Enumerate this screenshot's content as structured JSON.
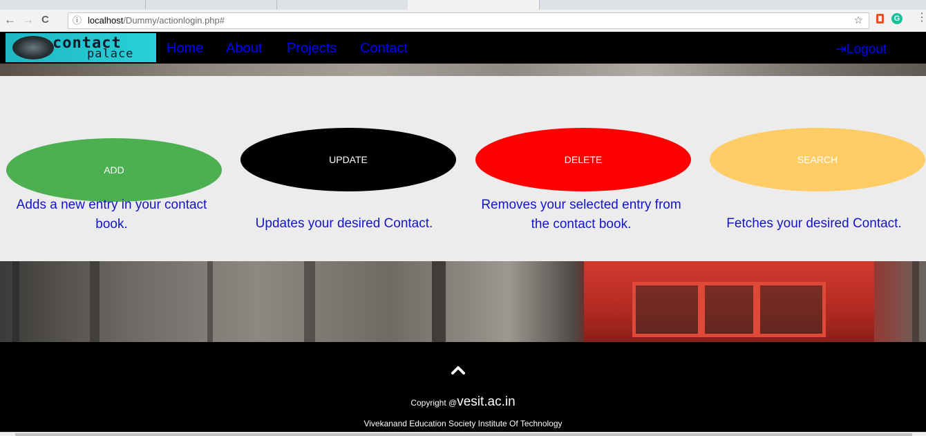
{
  "browser": {
    "back_icon": "←",
    "forward_icon": "→",
    "reload_icon": "C",
    "info_icon": "ⓘ",
    "url_host": "localhost",
    "url_path": "/Dummy/actionlogin.php#",
    "bookmark_icon": "☆",
    "extension_g_label": "G",
    "menu_icon": "⋮"
  },
  "navbar": {
    "logo_text": "contact",
    "logo_sub": "palace",
    "links": [
      "Home",
      "About",
      "Projects",
      "Contact"
    ],
    "logout_icon": "⇥",
    "logout_label": "Logout"
  },
  "actions": [
    {
      "label": "ADD",
      "color": "#4caf50",
      "description": "Adds a new entry in your contact book."
    },
    {
      "label": "UPDATE",
      "color": "#000000",
      "description": "Updates your desired Contact."
    },
    {
      "label": "DELETE",
      "color": "#ff0000",
      "description": "Removes your selected entry from the contact book."
    },
    {
      "label": "SEARCH",
      "color": "#ffcc66",
      "description": "Fetches your desired Contact."
    }
  ],
  "footer": {
    "copyright_prefix": "Copyright @",
    "copyright_domain": "vesit.ac.in",
    "institute": "Vivekanand Education Society Institute Of Technology"
  }
}
